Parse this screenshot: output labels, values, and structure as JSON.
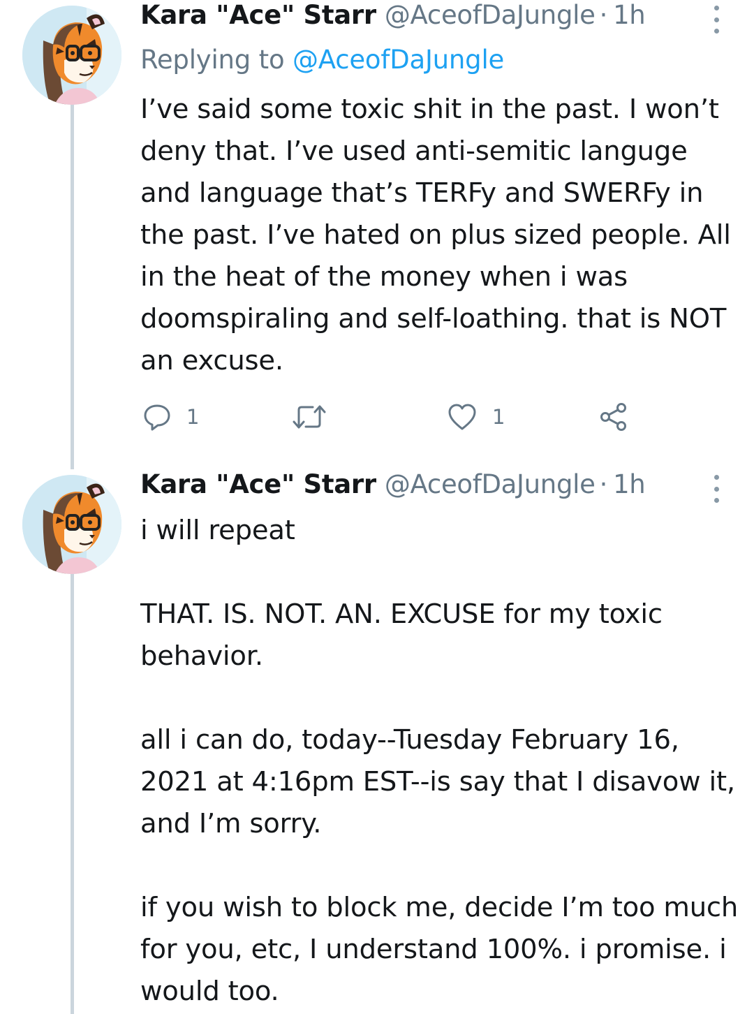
{
  "colors": {
    "name": "#14171a",
    "secondary": "#657786",
    "link": "#1da1f2",
    "thread_line": "#cbd5dd",
    "icon": "#8899a6"
  },
  "tweets": [
    {
      "author_name": "Kara \"Ace\" Starr",
      "handle": "@AceofDaJungle",
      "separator": "·",
      "time": "1h",
      "replying_prefix": "Replying to",
      "replying_to": "@AceofDaJungle",
      "avatar_icon": "tiger-avatar",
      "text": "I’ve said some toxic shit in the past. I won’t deny that. I’ve used anti-semitic languge and language that’s TERFy and SWERFy in the past. I’ve hated on plus sized people. All in the heat of the money when i was doomspiraling and self-loathing. that is NOT an excuse.",
      "actions": {
        "reply_count": "1",
        "retweet_count": "",
        "like_count": "1"
      }
    },
    {
      "author_name": "Kara \"Ace\" Starr",
      "handle": "@AceofDaJungle",
      "separator": "·",
      "time": "1h",
      "avatar_icon": "tiger-avatar",
      "paragraphs": [
        "i will repeat",
        "THAT. IS. NOT. AN. EXCUSE for my toxic behavior.",
        "all i can do, today--Tuesday February 16, 2021 at 4:16pm EST--is say that I disavow it, and I’m sorry.",
        "if you wish to block me, decide I’m too much for you, etc, I understand 100%. i promise. i would too."
      ]
    }
  ]
}
